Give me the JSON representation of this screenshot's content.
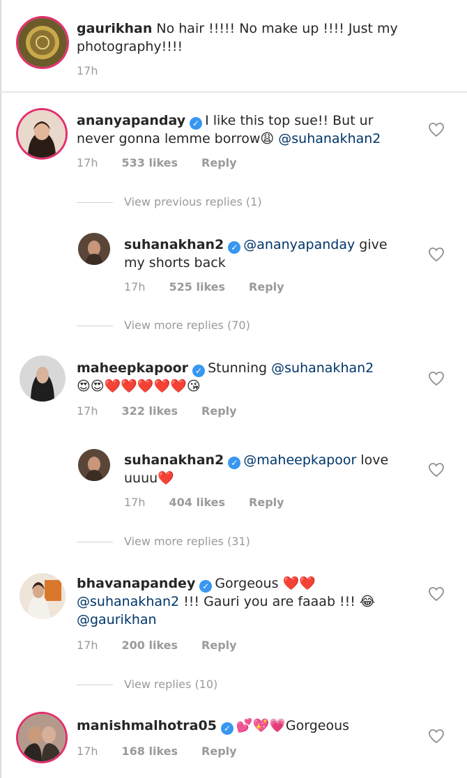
{
  "owner_comment": {
    "username": "gaurikhan",
    "text_line1": "No hair !!!!! No make up !!!! Just my",
    "text_line2": "photography!!!!",
    "time": "17h"
  },
  "comments": [
    {
      "username": "ananyapanday",
      "line1_text": "I like this top sue!! But ur",
      "line2_text": "never gonna lemme borrow😩",
      "line2_mention": "@suhanakhan2",
      "time": "17h",
      "likes": "533 likes",
      "reply": "Reply",
      "view_replies": "View previous replies (1)"
    },
    {
      "username": "suhanakhan2",
      "line1_mention": "@ananyapanday",
      "line1_text": "give",
      "line2_text": "my shorts back",
      "time": "17h",
      "likes": "525 likes",
      "reply": "Reply",
      "view_replies": "View more replies (70)"
    },
    {
      "username": "maheepkapoor",
      "line1_text": "Stunning",
      "line1_mention": "@suhanakhan2",
      "line2_text": "😍😍❤️❤️❤️❤️❤️😘",
      "time": "17h",
      "likes": "322 likes",
      "reply": "Reply"
    },
    {
      "username": "suhanakhan2",
      "line1_mention": "@maheepkapoor",
      "line1_text": "love",
      "line2_text": "uuuu❤️",
      "time": "17h",
      "likes": "404 likes",
      "reply": "Reply",
      "view_replies": "View more replies (31)"
    },
    {
      "username": "bhavanapandey",
      "line1_text": "Gorgeous ❤️❤️",
      "line2_mention": "@suhanakhan2",
      "line2_text": "!!! Gauri you are faaab !!! 😂",
      "line3_mention": "@gaurikhan",
      "time": "17h",
      "likes": "200 likes",
      "reply": "Reply",
      "view_replies": "View replies (10)"
    },
    {
      "username": "manishmalhotra05",
      "line1_text": "💕💖💗Gorgeous",
      "time": "17h",
      "likes": "168 likes",
      "reply": "Reply"
    }
  ],
  "icons": {
    "verified": "verified-badge-icon",
    "like": "heart-outline-icon"
  },
  "colors": {
    "verified": "#3897f0",
    "mention": "#003569",
    "meta": "#9a9a9a",
    "story_ring": "#e1306c"
  }
}
